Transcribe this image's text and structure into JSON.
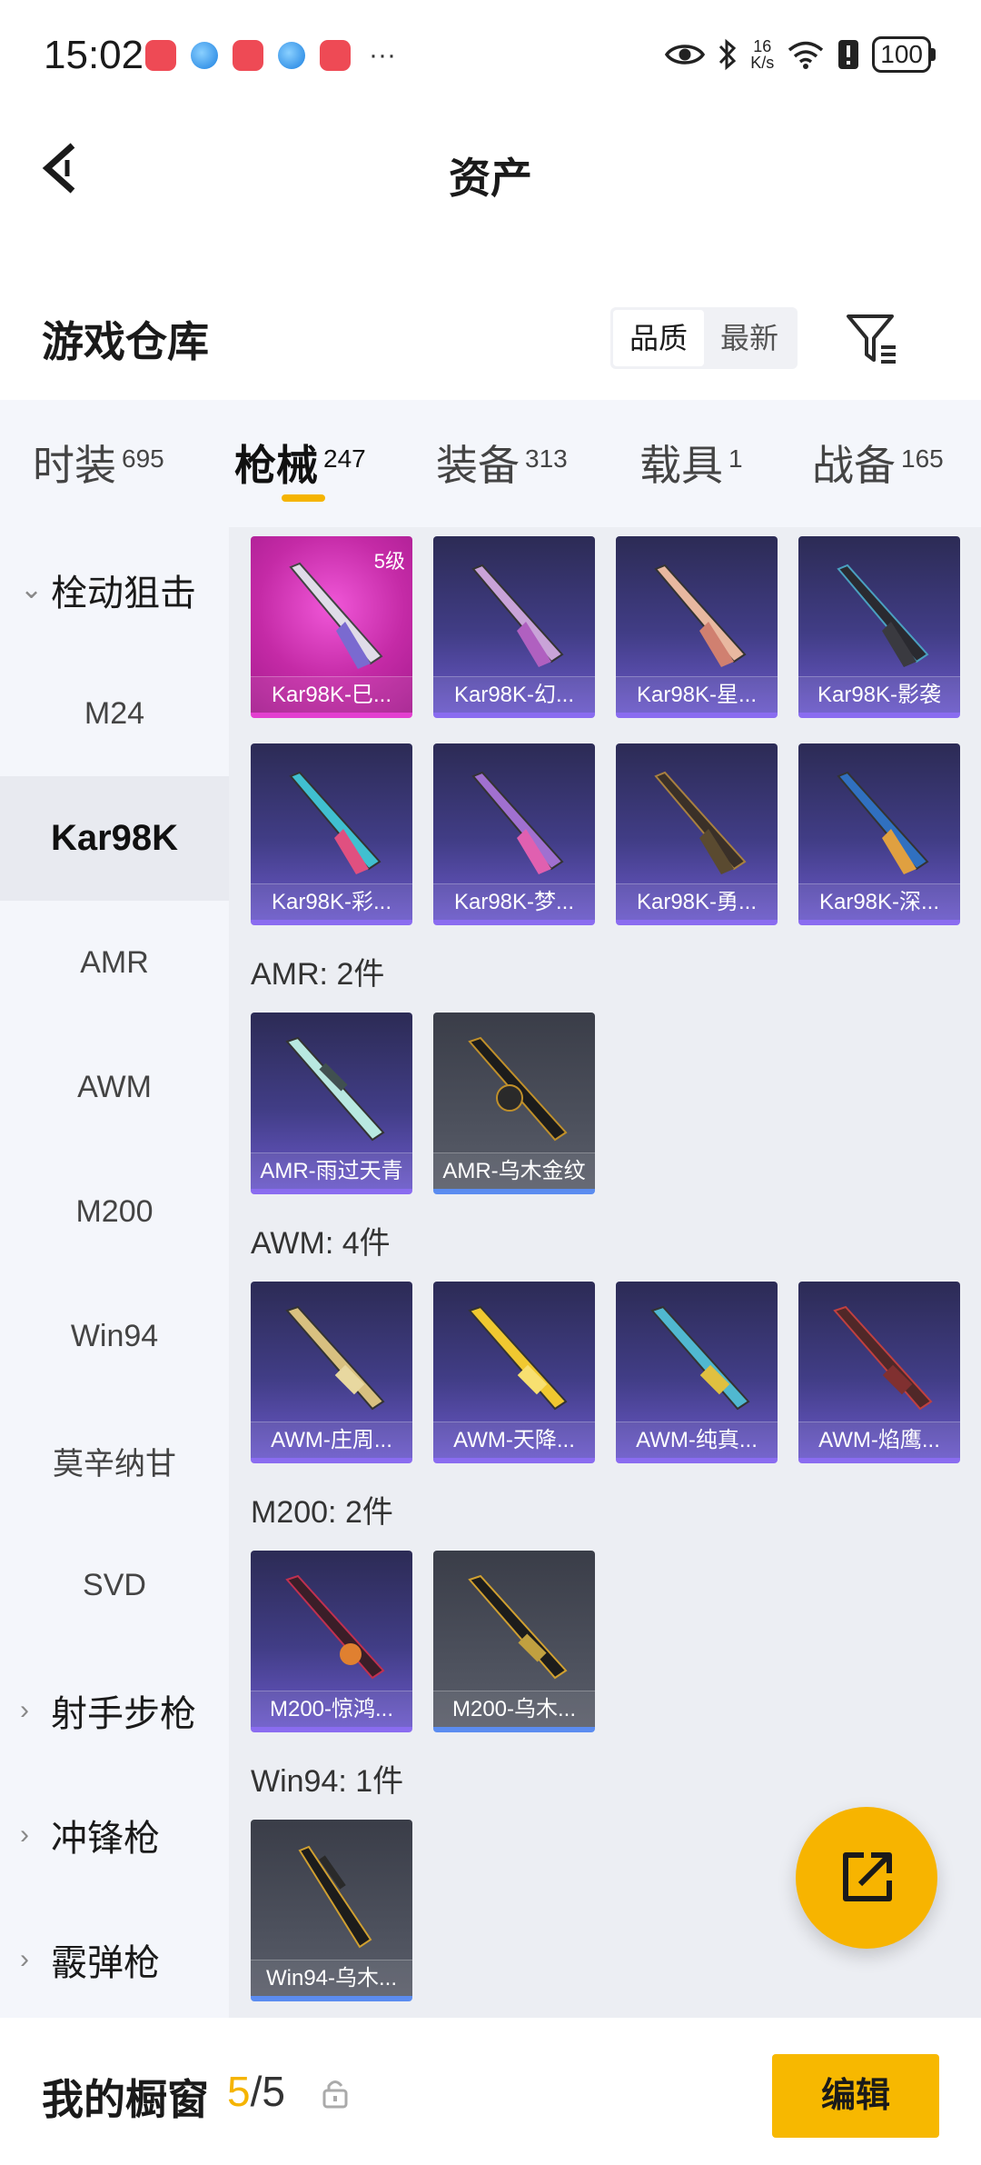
{
  "status_bar": {
    "time": "15:02",
    "more": "···",
    "net_speed_value": "16",
    "net_speed_unit": "K/s",
    "battery": "100"
  },
  "nav": {
    "title": "资产",
    "back_icon": "chevron-left-icon"
  },
  "warehouse": {
    "title": "游戏仓库",
    "sort_options": [
      "品质",
      "最新"
    ],
    "sort_selected": "品质",
    "filter_icon": "filter-icon"
  },
  "tabs": [
    {
      "label": "时装",
      "count": "695"
    },
    {
      "label": "枪械",
      "count": "247",
      "active": true
    },
    {
      "label": "装备",
      "count": "313"
    },
    {
      "label": "载具",
      "count": "1"
    },
    {
      "label": "战备",
      "count": "165"
    }
  ],
  "sidebar": {
    "items": [
      {
        "label": "栓动狙击",
        "type": "group",
        "expanded": true
      },
      {
        "label": "M24"
      },
      {
        "label": "Kar98K",
        "active": true
      },
      {
        "label": "AMR"
      },
      {
        "label": "AWM"
      },
      {
        "label": "M200"
      },
      {
        "label": "Win94"
      },
      {
        "label": "莫辛纳甘"
      },
      {
        "label": "SVD"
      },
      {
        "label": "射手步枪",
        "type": "group"
      },
      {
        "label": "冲锋枪",
        "type": "group"
      },
      {
        "label": "霰弹枪",
        "type": "group"
      }
    ]
  },
  "sections": {
    "kar98k": {
      "items": [
        {
          "name": "Kar98K-巳...",
          "level": "5级"
        },
        {
          "name": "Kar98K-幻..."
        },
        {
          "name": "Kar98K-星..."
        },
        {
          "name": "Kar98K-影袭"
        },
        {
          "name": "Kar98K-彩..."
        },
        {
          "name": "Kar98K-梦..."
        },
        {
          "name": "Kar98K-勇..."
        },
        {
          "name": "Kar98K-深..."
        }
      ]
    },
    "amr": {
      "label": "AMR: 2件",
      "items": [
        {
          "name": "AMR-雨过天青"
        },
        {
          "name": "AMR-乌木金纹"
        }
      ]
    },
    "awm": {
      "label": "AWM: 4件",
      "items": [
        {
          "name": "AWM-庄周..."
        },
        {
          "name": "AWM-天降..."
        },
        {
          "name": "AWM-纯真..."
        },
        {
          "name": "AWM-焰鹰..."
        }
      ]
    },
    "m200": {
      "label": "M200: 2件",
      "items": [
        {
          "name": "M200-惊鸿..."
        },
        {
          "name": "M200-乌木..."
        }
      ]
    },
    "win94": {
      "label": "Win94: 1件",
      "items": [
        {
          "name": "Win94-乌木..."
        }
      ]
    }
  },
  "fab": {
    "icon": "share-external-icon"
  },
  "bottom": {
    "title": "我的橱窗",
    "count_current": "5",
    "count_sep": "/",
    "count_total": "5",
    "lock_icon": "lock-icon",
    "edit_label": "编辑"
  },
  "colors": {
    "accent": "#F7B400",
    "rarity_purple": "#8A6CF0",
    "rarity_pink": "#E33FD0",
    "rarity_blue": "#5B8CF0"
  }
}
